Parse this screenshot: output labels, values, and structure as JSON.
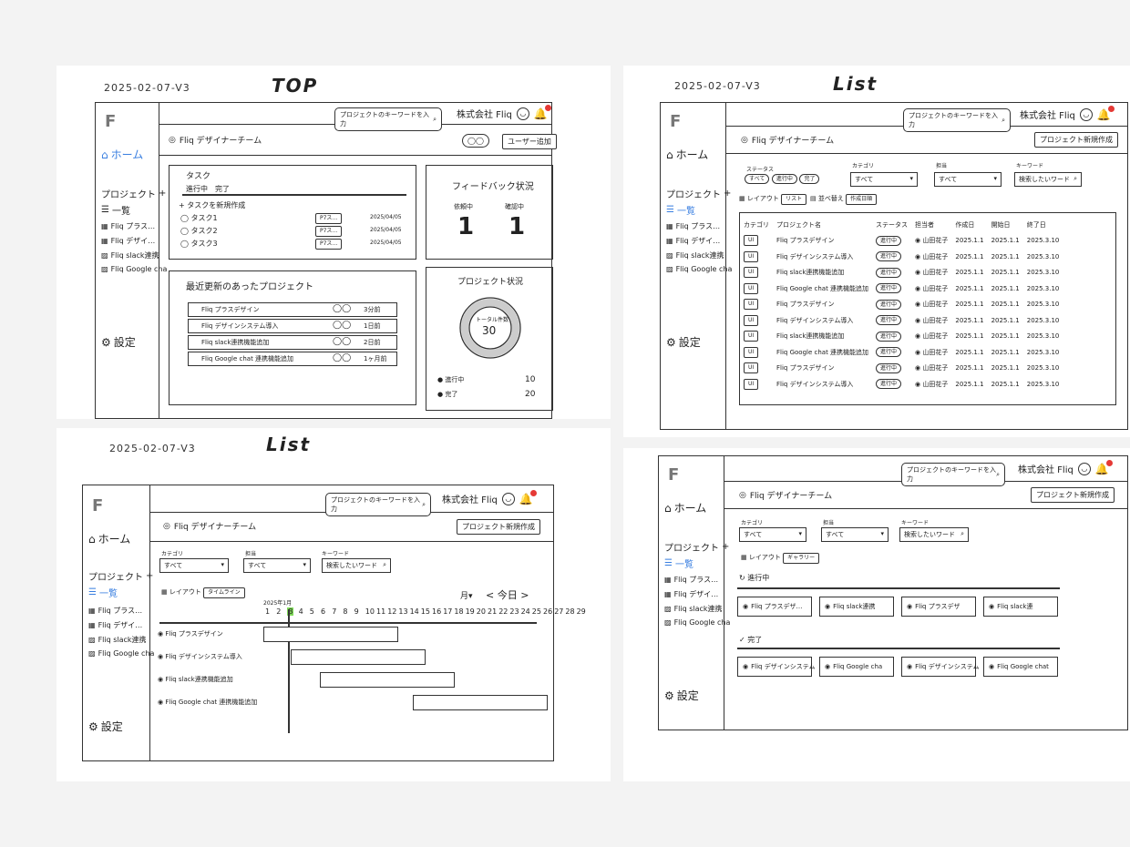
{
  "boards": {
    "top": {
      "date": "2025-02-07-V3",
      "title": "TOP"
    },
    "list_table": {
      "date": "2025-02-07-V3",
      "title": "List"
    },
    "list_gantt": {
      "date": "2025-02-07-V3",
      "title": "List"
    }
  },
  "common": {
    "logo": "F",
    "home": "ホーム",
    "projects": "プロジェクト",
    "plus": "+",
    "list": "一覧",
    "settings": "設定",
    "company": "株式会社 Fliq",
    "bell_icon": "bell-icon",
    "search_placeholder": "プロジェクトのキーワードを入力",
    "team": "Fliq デザイナーチーム",
    "new_project": "プロジェクト新規作成",
    "side_projects": [
      "Fliq プラス…",
      "Fliq デザイ…",
      "Fliq slack連携",
      "Fliq Google cha"
    ]
  },
  "top": {
    "add_user": "ユーザー追加",
    "task_title": "タスク",
    "task_tabs": [
      "進行中",
      "完了"
    ],
    "task_add": "+ タスクを新規作成",
    "tasks": [
      {
        "name": "タスク1",
        "tag": "P7ス…",
        "date": "2025/04/05"
      },
      {
        "name": "タスク2",
        "tag": "P7ス…",
        "date": "2025/04/05"
      },
      {
        "name": "タスク3",
        "tag": "P7ス…",
        "date": "2025/04/05"
      }
    ],
    "feedback_title": "フィードバック状況",
    "feedback_labels": [
      "依頼中",
      "確認中"
    ],
    "feedback_values": [
      "1",
      "1"
    ],
    "recent_title": "最近更新のあったプロジェクト",
    "recent": [
      {
        "name": "Fliq プラスデザイン",
        "time": "3分前"
      },
      {
        "name": "Fliq デザインシステム導入",
        "time": "1日前"
      },
      {
        "name": "Fliq slack連携機能追加",
        "time": "2日前"
      },
      {
        "name": "Fliq Google chat 連携機能追加",
        "time": "1ヶ月前"
      }
    ],
    "project_status_title": "プロジェクト状況",
    "donut_label": "トータル件数",
    "donut_value": "30",
    "legend": [
      {
        "label": "進行中",
        "value": "10"
      },
      {
        "label": "完了",
        "value": "20"
      }
    ]
  },
  "list_table": {
    "filters": {
      "status_label": "ステータス",
      "status_chips": [
        "すべて",
        "進行中",
        "完了"
      ],
      "category_label": "カテゴリ",
      "category_value": "すべて",
      "owner_label": "担当",
      "owner_value": "すべて",
      "keyword_label": "キーワード",
      "keyword_placeholder": "検索したいワード"
    },
    "layout_label": "レイアウト",
    "layout_value": "リスト",
    "sort_label": "並べ替え",
    "sort_value": "作成日順",
    "columns": [
      "カテゴリ",
      "プロジェクト名",
      "ステータス",
      "担当者",
      "作成日",
      "開始日",
      "終了日"
    ],
    "rows": [
      [
        "UI",
        "Fliq プラスデザイン",
        "進行中",
        "山田花子",
        "2025.1.1",
        "2025.1.1",
        "2025.3.10"
      ],
      [
        "UI",
        "Fliq デザインシステム導入",
        "進行中",
        "山田花子",
        "2025.1.1",
        "2025.1.1",
        "2025.3.10"
      ],
      [
        "UI",
        "Fliq slack連携機能追加",
        "進行中",
        "山田花子",
        "2025.1.1",
        "2025.1.1",
        "2025.3.10"
      ],
      [
        "UI",
        "Fliq Google chat 連携機能追加",
        "進行中",
        "山田花子",
        "2025.1.1",
        "2025.1.1",
        "2025.3.10"
      ],
      [
        "UI",
        "Fliq プラスデザイン",
        "進行中",
        "山田花子",
        "2025.1.1",
        "2025.1.1",
        "2025.3.10"
      ],
      [
        "UI",
        "Fliq デザインシステム導入",
        "進行中",
        "山田花子",
        "2025.1.1",
        "2025.1.1",
        "2025.3.10"
      ],
      [
        "UI",
        "Fliq slack連携機能追加",
        "進行中",
        "山田花子",
        "2025.1.1",
        "2025.1.1",
        "2025.3.10"
      ],
      [
        "UI",
        "Fliq Google chat 連携機能追加",
        "進行中",
        "山田花子",
        "2025.1.1",
        "2025.1.1",
        "2025.3.10"
      ],
      [
        "UI",
        "Fliq プラスデザイン",
        "進行中",
        "山田花子",
        "2025.1.1",
        "2025.1.1",
        "2025.3.10"
      ],
      [
        "UI",
        "Fliq デザインシステム導入",
        "進行中",
        "山田花子",
        "2025.1.1",
        "2025.1.1",
        "2025.3.10"
      ]
    ]
  },
  "list_gantt": {
    "filters": {
      "category_label": "カテゴリ",
      "category_value": "すべて",
      "owner_label": "担当",
      "owner_value": "すべて",
      "keyword_label": "キーワード",
      "keyword_placeholder": "検索したいワード"
    },
    "layout_label": "レイアウト",
    "layout_value": "タイムライン",
    "month": "2025年1月",
    "month_select": "月",
    "today": "今日",
    "days": [
      "1",
      "2",
      "3",
      "4",
      "5",
      "6",
      "7",
      "8",
      "9",
      "10",
      "11",
      "12",
      "13",
      "14",
      "15",
      "16",
      "17",
      "18",
      "19",
      "20",
      "21",
      "22",
      "23",
      "24",
      "25",
      "26",
      "27",
      "28",
      "29"
    ],
    "today_day": "3",
    "projects": [
      "Fliq プラスデザイン",
      "Fliq デザインシステム導入",
      "Fliq slack連携機能追加",
      "Fliq Google chat 連携機能追加"
    ]
  },
  "gallery": {
    "filters": {
      "category_label": "カテゴリ",
      "category_value": "すべて",
      "owner_label": "担当",
      "owner_value": "すべて",
      "keyword_label": "キーワード",
      "keyword_placeholder": "検索したいワード"
    },
    "layout_label": "レイアウト",
    "layout_value": "ギャラリー",
    "in_progress": "進行中",
    "done": "完了",
    "in_progress_cards": [
      "Fliq プラスデザ…",
      "Fliq slack連携",
      "Fliq プラスデザ",
      "Fliq slack連"
    ],
    "done_cards": [
      "Fliq デザインシステム",
      "Fliq Google cha",
      "Fliq デザインシステム",
      "Fliq Google chat"
    ]
  }
}
